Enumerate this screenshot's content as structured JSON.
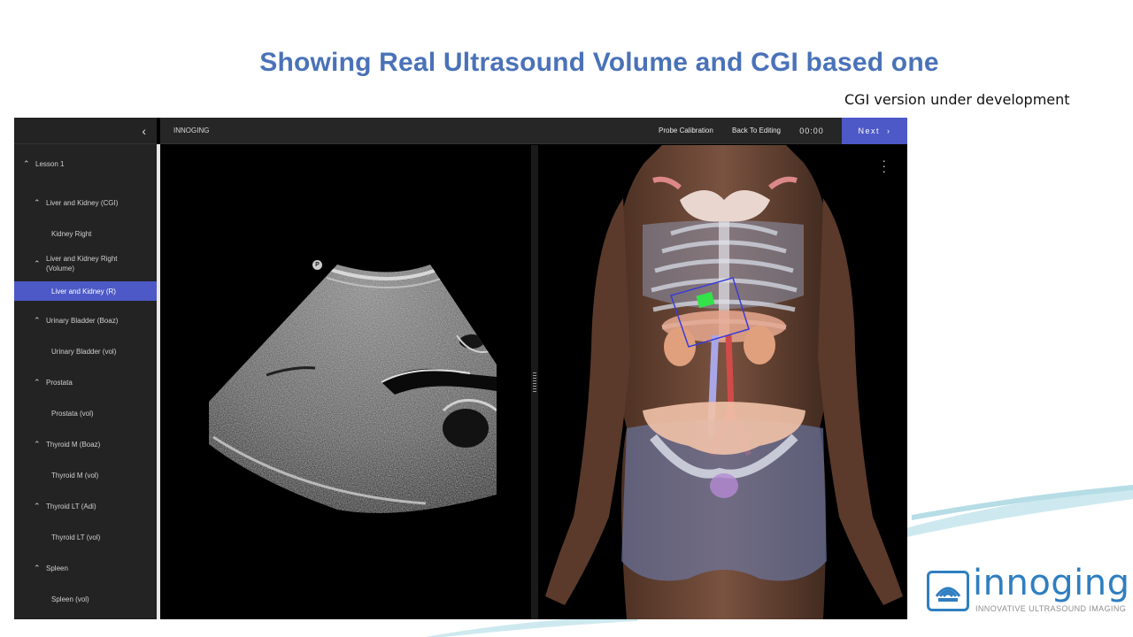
{
  "slide": {
    "title": "Showing Real Ultrasound Volume and CGI based one",
    "subtitle": "CGI version under development"
  },
  "app": {
    "brand": "INNOGING",
    "collapse_icon": "chevron-left-icon",
    "toolbar": {
      "probe_calibration": "Probe Calibration",
      "back_to_editing": "Back To Editing",
      "timer": "00:00",
      "next_label": "Next",
      "next_icon": "chevron-right-icon"
    },
    "accent_color": "#4c59c6",
    "sidebar": {
      "items": [
        {
          "label": "Lesson 1",
          "level": 0,
          "expandable": true,
          "active": false
        },
        {
          "label": "Liver and Kidney (CGI)",
          "level": 1,
          "expandable": true,
          "active": false
        },
        {
          "label": "Kidney Right",
          "level": 2,
          "expandable": false,
          "active": false
        },
        {
          "label": "Liver and Kidney Right (Volume)",
          "level": 1,
          "expandable": true,
          "active": false
        },
        {
          "label": "Liver and Kidney (R)",
          "level": 2,
          "expandable": false,
          "active": true
        },
        {
          "label": "Urinary Bladder (Boaz)",
          "level": 1,
          "expandable": true,
          "active": false
        },
        {
          "label": "Urinary Bladder (vol)",
          "level": 2,
          "expandable": false,
          "active": false
        },
        {
          "label": "Prostata",
          "level": 1,
          "expandable": true,
          "active": false
        },
        {
          "label": "Prostata (vol)",
          "level": 2,
          "expandable": false,
          "active": false
        },
        {
          "label": "Thyroid M (Boaz)",
          "level": 1,
          "expandable": true,
          "active": false
        },
        {
          "label": "Thyroid M (vol)",
          "level": 2,
          "expandable": false,
          "active": false
        },
        {
          "label": "Thyroid LT (Adi)",
          "level": 1,
          "expandable": true,
          "active": false
        },
        {
          "label": "Thyroid LT (vol)",
          "level": 2,
          "expandable": false,
          "active": false
        },
        {
          "label": "Spleen",
          "level": 1,
          "expandable": true,
          "active": false
        },
        {
          "label": "Spleen (vol)",
          "level": 2,
          "expandable": false,
          "active": false
        }
      ]
    },
    "us_view": {
      "orientation_marker": "P"
    }
  },
  "logo": {
    "word": "innoging",
    "tagline": "INNOVATIVE ULTRASOUND IMAGING",
    "color": "#2f7ec0"
  }
}
